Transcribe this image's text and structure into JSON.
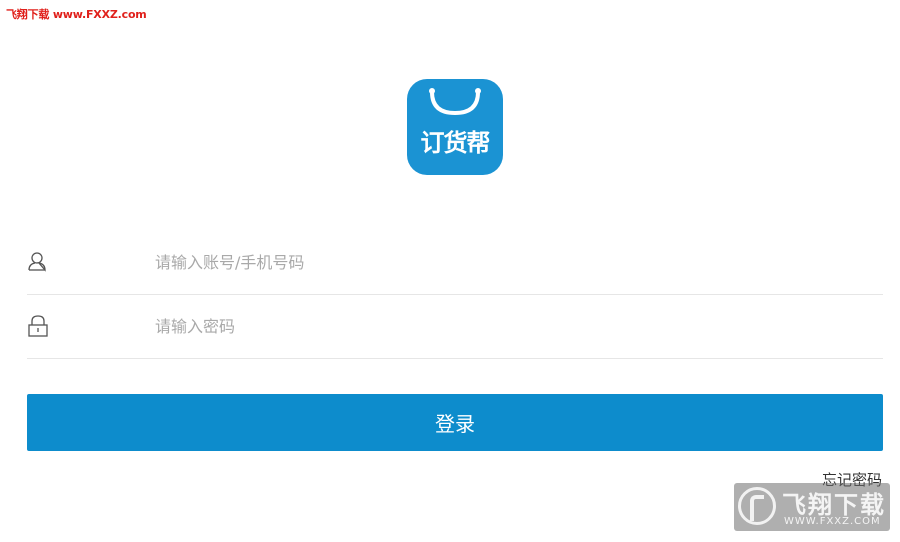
{
  "watermark": {
    "top_text": "飞翔下载 www.FXXZ.com",
    "badge_name": "飞翔下载",
    "badge_url": "WWW.FXXZ.COM"
  },
  "app": {
    "logo_text": "订货帮",
    "brand_color": "#1b93d3"
  },
  "login": {
    "account_placeholder": "请输入账号/手机号码",
    "account_value": "",
    "password_placeholder": "请输入密码",
    "password_value": "",
    "submit_label": "登录",
    "submit_color": "#0d8ccc",
    "forgot_label": "忘记密码"
  },
  "icons": {
    "account": "user-icon",
    "password": "lock-icon"
  }
}
